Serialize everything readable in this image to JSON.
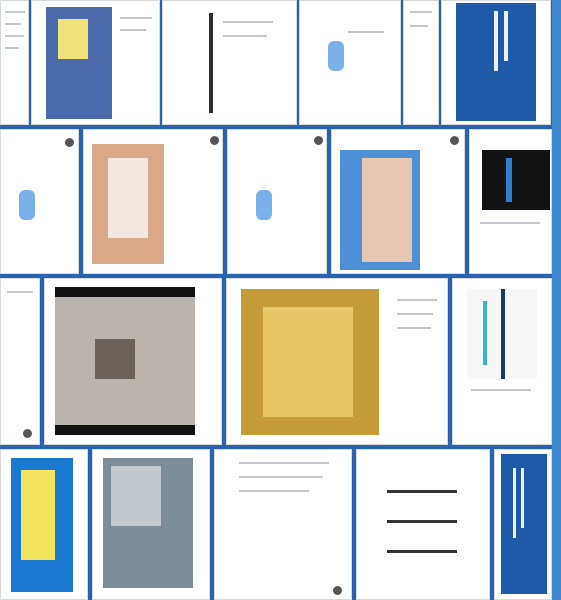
{
  "collage": {
    "background": "#2a63ad",
    "edge_strip": "#3f87cf",
    "tile_background": "#ffffff",
    "columns": [
      {
        "tiles": [
          "text-post",
          "infographic-post",
          "photo-post",
          "text-post",
          "promo-button-post",
          "banner-post"
        ]
      },
      {
        "tiles": [
          "promo-button-post",
          "group-photo-post",
          "promo-button-post",
          "team-photo-post",
          "dark-card-post"
        ]
      },
      {
        "tiles": [
          "text-post",
          "video-post",
          "photo-post",
          "chart-post"
        ]
      },
      {
        "tiles": [
          "infographic-post",
          "photo-post",
          "text-post",
          "handwriting-post",
          "banner-post"
        ]
      }
    ]
  }
}
